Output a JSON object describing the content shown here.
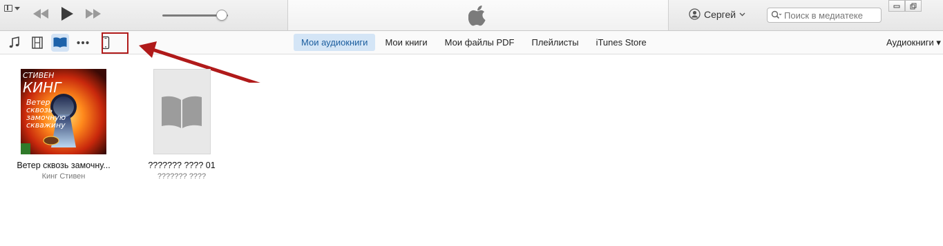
{
  "player": {
    "account_name": "Сергей",
    "search_placeholder": "Поиск в медиатеке",
    "volume_level": 0.9
  },
  "toolbar": {
    "media_icons": [
      "music-note-icon",
      "film-icon",
      "book-icon",
      "more-dots-icon",
      "iphone-device-icon"
    ],
    "active_media": "book-icon",
    "tabs": [
      {
        "label": "Мои аудиокниги",
        "active": true
      },
      {
        "label": "Мои книги",
        "active": false
      },
      {
        "label": "Мои файлы PDF",
        "active": false
      },
      {
        "label": "Плейлисты",
        "active": false
      },
      {
        "label": "iTunes Store",
        "active": false
      }
    ],
    "view_selector": "Аудиокниги ▾"
  },
  "library": {
    "books": [
      {
        "title": "Ветер сквозь замочну...",
        "author": "Кинг Стивен",
        "cover_text": [
          "СТИВЕН",
          "КИНГ",
          "Ветер",
          "сквозь",
          "замочную",
          "скважину"
        ]
      },
      {
        "title": "??????? ???? 01",
        "author": "??????? ????"
      }
    ]
  },
  "annotation": {
    "highlight_color": "#b01a1a"
  },
  "colors": {
    "accent": "#1b5d9e",
    "tab_active_bg": "#d4e5f6"
  }
}
